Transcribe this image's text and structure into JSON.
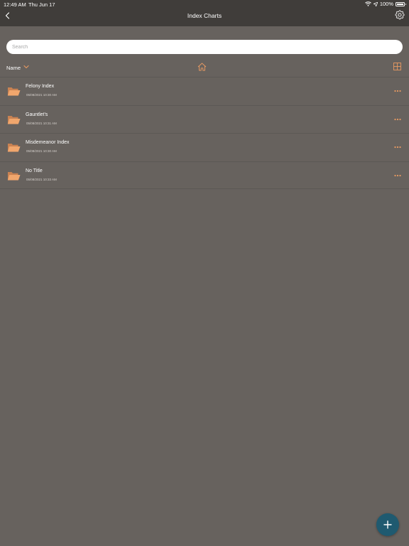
{
  "status_bar": {
    "time": "12:49 AM",
    "date": "Thu Jun 17",
    "battery": "100%"
  },
  "nav": {
    "title": "Index Charts",
    "back_icon": "chevron-left-icon",
    "settings_icon": "gear-icon"
  },
  "search": {
    "placeholder": "Search"
  },
  "sort": {
    "label": "Name"
  },
  "colors": {
    "accent": "#e89a62",
    "background": "#67625e",
    "header": "#403d3a",
    "fab": "#1f5a70"
  },
  "items": [
    {
      "title": "Felony Index",
      "date": "05/08/2021 10:30 AM"
    },
    {
      "title": "Gauntlet's",
      "date": "05/08/2021 10:31 AM"
    },
    {
      "title": "Misdemeanor Index",
      "date": "05/08/2021 10:30 AM"
    },
    {
      "title": "No Title",
      "date": "05/08/2021 10:33 AM"
    }
  ]
}
